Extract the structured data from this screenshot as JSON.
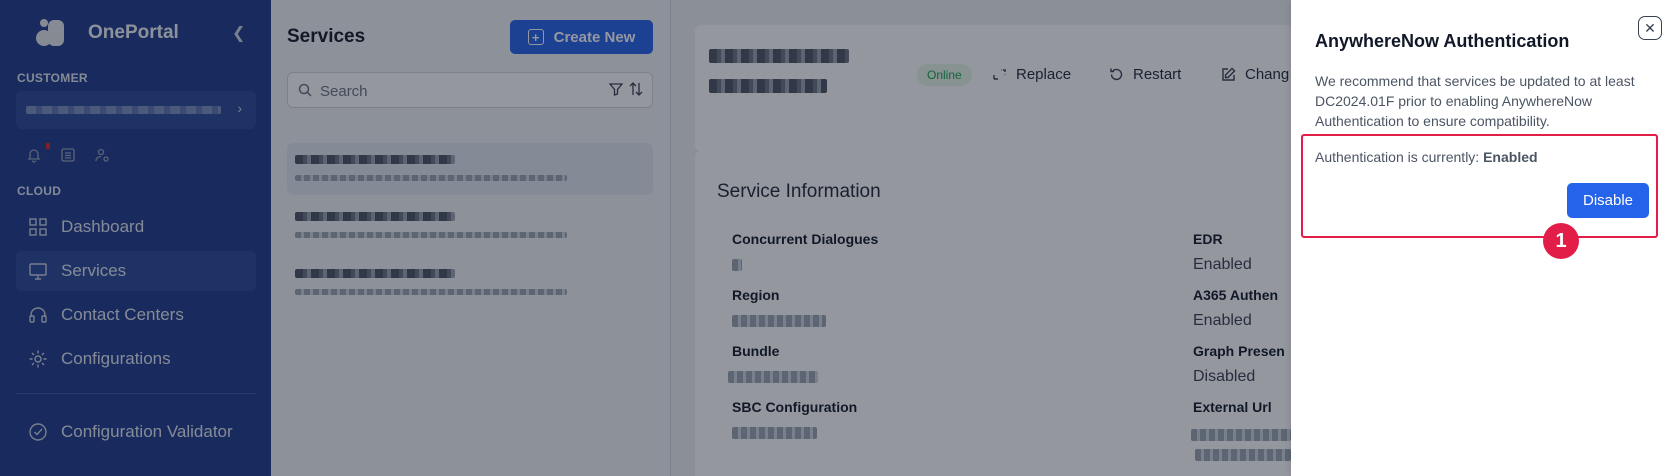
{
  "app": {
    "name": "OnePortal",
    "collapse_icon": "chevron-left-icon"
  },
  "sidebar": {
    "customer_label": "CUSTOMER",
    "customer_value": "",
    "cloud_label": "CLOUD",
    "items": [
      {
        "label": "Dashboard",
        "icon": "grid-icon"
      },
      {
        "label": "Services",
        "icon": "monitor-icon",
        "active": true
      },
      {
        "label": "Contact Centers",
        "icon": "headset-icon"
      },
      {
        "label": "Configurations",
        "icon": "gear-icon"
      },
      {
        "label": "Configuration Validator",
        "icon": "check-circle-icon"
      }
    ],
    "util_icons": [
      "bell-icon",
      "list-icon",
      "user-settings-icon"
    ]
  },
  "services": {
    "title": "Services",
    "create_label": "Create New",
    "search_placeholder": "Search",
    "filter_icon": "filter-icon",
    "sort_icon": "sort-icon"
  },
  "detail": {
    "status": "Online",
    "actions": {
      "replace": "Replace",
      "restart": "Restart",
      "change": "Chang"
    },
    "section_title": "Service Information",
    "left_fields": [
      {
        "label": "Concurrent Dialogues",
        "value": ""
      },
      {
        "label": "Region",
        "value": ""
      },
      {
        "label": "Bundle",
        "value": ""
      },
      {
        "label": "SBC Configuration",
        "value": ""
      }
    ],
    "right_fields": [
      {
        "label": "EDR",
        "value": "Enabled"
      },
      {
        "label": "A365 Authen",
        "value": "Enabled"
      },
      {
        "label": "Graph Presen",
        "value": "Disabled"
      },
      {
        "label": "External Url",
        "value": ""
      }
    ]
  },
  "drawer": {
    "title": "AnywhereNow Authentication",
    "description": "We recommend that services be updated to at least DC2024.01F prior to enabling AnywhereNow Authentication to ensure compatibility.",
    "status_prefix": "Authentication is currently: ",
    "status_value": "Enabled",
    "disable_label": "Disable",
    "step_number": "1",
    "close_icon": "close-icon"
  },
  "colors": {
    "sidebar": "#1e3a8a",
    "primary": "#2563eb",
    "highlight": "#e11d48",
    "online": "#16a34a"
  }
}
